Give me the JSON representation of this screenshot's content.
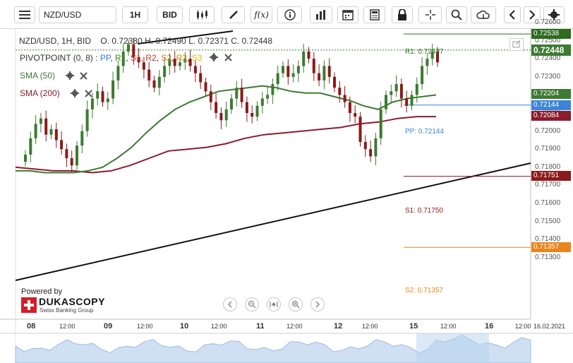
{
  "toolbar": {
    "symbol": "NZD/USD",
    "timeframe": "1H",
    "side": "BID"
  },
  "header": {
    "instrument": "NZD/USD, 1H, BID",
    "open_label": "O.",
    "open": "0.72380",
    "high_label": "H.",
    "high": "0.72490",
    "low_label": "L.",
    "low": "0.72371",
    "close_label": "C.",
    "close": "0.72448"
  },
  "indicators": {
    "pivot": {
      "label": "PIVOTPOINT (0, 8)",
      "pp": "PP",
      "r1": "R1",
      "s1": "S1",
      "r2": "R2",
      "s2": "S2",
      "r3": "R3",
      "s3": "S3"
    },
    "sma50": {
      "label": "SMA (50)",
      "color": "#3d7a32"
    },
    "sma200": {
      "label": "SMA (200)",
      "color": "#8a1c2e"
    }
  },
  "levels": {
    "r1": {
      "text": "R1: 0.72537",
      "price_tag": "0.72538",
      "color": "#2e6b1f"
    },
    "pp": {
      "text": "PP: 0.72144",
      "price_tag": "0.72144",
      "color": "#3b84d6"
    },
    "s1": {
      "text": "S1: 0.71750",
      "price_tag": "0.71751",
      "color": "#8b1a1a"
    },
    "s2": {
      "text": "S2: 0.71357",
      "price_tag": "0.71357",
      "color": "#e8861c"
    },
    "last": {
      "price_tag": "0.72448",
      "color": "#3d7a32"
    },
    "sma50_tag": {
      "price_tag": "0.72204",
      "color": "#3d7a32"
    },
    "sma200_tag": {
      "price_tag": "0.72084",
      "color": "#8a1c2e"
    }
  },
  "branding": {
    "powered_by": "Powered by",
    "name": "DUKASCOPY",
    "tagline": "Swiss Banking Group"
  },
  "chart_data": {
    "type": "candlestick",
    "title": "NZD/USD, 1H, BID",
    "y_ticks": [
      "0.72600",
      "0.72500",
      "0.72400",
      "0.72300",
      "0.72200",
      "0.72100",
      "0.72000",
      "0.71900",
      "0.71800",
      "0.71700",
      "0.71600",
      "0.71500",
      "0.71400",
      "0.71300"
    ],
    "ylim": [
      0.7128,
      0.7265
    ],
    "x_ticks": [
      {
        "label": "08",
        "bold": true
      },
      {
        "label": "12:00",
        "bold": false
      },
      {
        "label": "09",
        "bold": true
      },
      {
        "label": "12:00",
        "bold": false
      },
      {
        "label": "10",
        "bold": true
      },
      {
        "label": "12:00",
        "bold": false
      },
      {
        "label": "11",
        "bold": true
      },
      {
        "label": "12:00",
        "bold": false
      },
      {
        "label": "12",
        "bold": true
      },
      {
        "label": "12:00",
        "bold": false
      },
      {
        "label": "15",
        "bold": true
      },
      {
        "label": "12:00",
        "bold": false
      },
      {
        "label": "16",
        "bold": true
      },
      {
        "label": "12:00",
        "bold": false
      },
      {
        "label": "16.02.2021",
        "bold": false
      }
    ],
    "close_series": [
      0.7187,
      0.7196,
      0.7204,
      0.7207,
      0.7198,
      0.7201,
      0.7195,
      0.719,
      0.7185,
      0.7181,
      0.7192,
      0.72,
      0.7212,
      0.7218,
      0.7222,
      0.7216,
      0.7218,
      0.7228,
      0.7236,
      0.7244,
      0.7248,
      0.7241,
      0.7238,
      0.7234,
      0.7228,
      0.7224,
      0.723,
      0.7236,
      0.724,
      0.7236,
      0.7238,
      0.724,
      0.7236,
      0.7232,
      0.7227,
      0.7222,
      0.7216,
      0.721,
      0.7206,
      0.7212,
      0.7218,
      0.7224,
      0.7216,
      0.721,
      0.7208,
      0.7214,
      0.7218,
      0.722,
      0.7226,
      0.7232,
      0.7236,
      0.723,
      0.7232,
      0.7236,
      0.7244,
      0.724,
      0.7232,
      0.7228,
      0.7236,
      0.723,
      0.7224,
      0.722,
      0.7216,
      0.721,
      0.7208,
      0.7194,
      0.719,
      0.7186,
      0.7196,
      0.7212,
      0.722,
      0.7222,
      0.7226,
      0.7218,
      0.7214,
      0.722,
      0.7226,
      0.7236,
      0.724,
      0.7244,
      0.7238
    ],
    "sma50": [
      0.7178,
      0.7178,
      0.7177,
      0.7177,
      0.7177,
      0.7178,
      0.718,
      0.7185,
      0.7191,
      0.7199,
      0.7206,
      0.7212,
      0.7216,
      0.7219,
      0.7222,
      0.7223,
      0.7224,
      0.7225,
      0.7224,
      0.7222,
      0.7221,
      0.7221,
      0.7219,
      0.7217,
      0.7214,
      0.7212,
      0.7216,
      0.7218,
      0.7219,
      0.722
    ],
    "sma200": [
      0.718,
      0.7179,
      0.7178,
      0.7178,
      0.7177,
      0.7178,
      0.7181,
      0.7185,
      0.7189,
      0.719,
      0.7191,
      0.7193,
      0.7196,
      0.7198,
      0.7199,
      0.72,
      0.7201,
      0.7202,
      0.7204,
      0.7205,
      0.7207,
      0.7208,
      0.7208
    ],
    "pivot_levels": {
      "R1": 0.72537,
      "PP": 0.72144,
      "S1": 0.7175,
      "S2": 0.71357
    }
  }
}
